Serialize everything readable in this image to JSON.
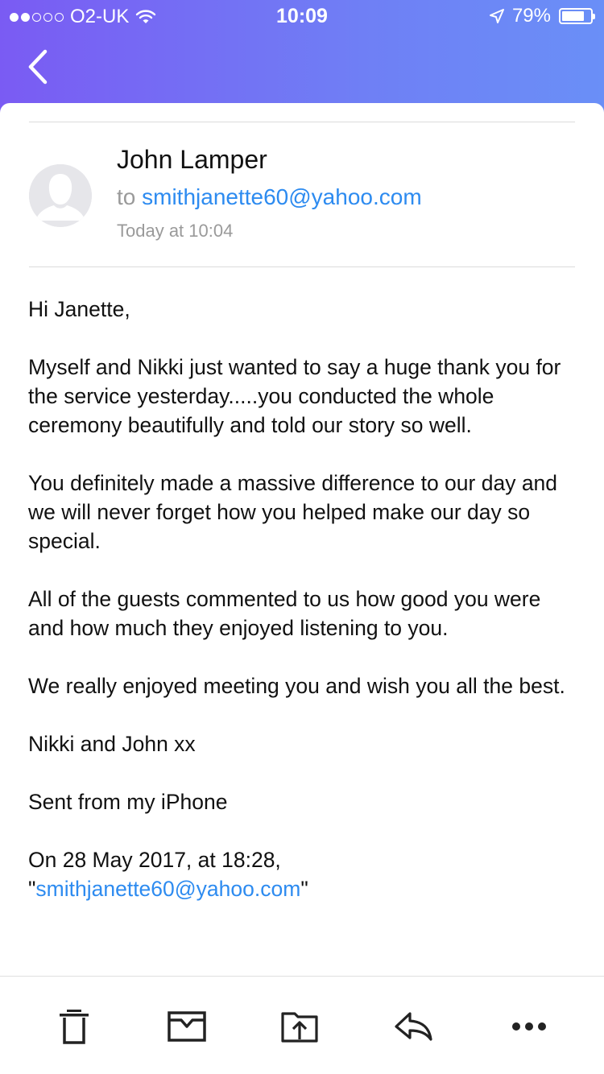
{
  "status_bar": {
    "carrier": "O2-UK",
    "time": "10:09",
    "battery": "79%",
    "battery_level": 0.79,
    "signal_bars": 2
  },
  "nav": {
    "back_icon": "chevron-left-icon"
  },
  "email": {
    "sender": "John Lamper",
    "to_prefix": "to",
    "to_address": "smithjanette60@yahoo.com",
    "date": "Today at 10:04",
    "body": {
      "greeting": "Hi Janette,",
      "p1": "Myself and Nikki just wanted to say a huge thank you for the service yesterday.....you conducted the whole ceremony beautifully and told our story so well.",
      "p2": "You definitely made a massive difference to our day and we will never forget how you helped make our day so special.",
      "p3": "All of the guests commented to us how good you were and how much they enjoyed listening to you.",
      "p4": "We really enjoyed meeting you and wish you all the best.",
      "signoff": "Nikki and John xx",
      "sent_from": "Sent from my iPhone",
      "quote_header": "On 28 May 2017, at 18:28,",
      "quote_open": "\"",
      "quote_address": "smithjanette60@yahoo.com",
      "quote_close": "\""
    }
  },
  "toolbar": {
    "items": [
      "trash-icon",
      "archive-icon",
      "move-icon",
      "reply-icon",
      "more-icon"
    ]
  },
  "colors": {
    "header_gradient_start": "#7a5bf3",
    "header_gradient_end": "#6a8ff7",
    "link": "#2d8bf0"
  }
}
